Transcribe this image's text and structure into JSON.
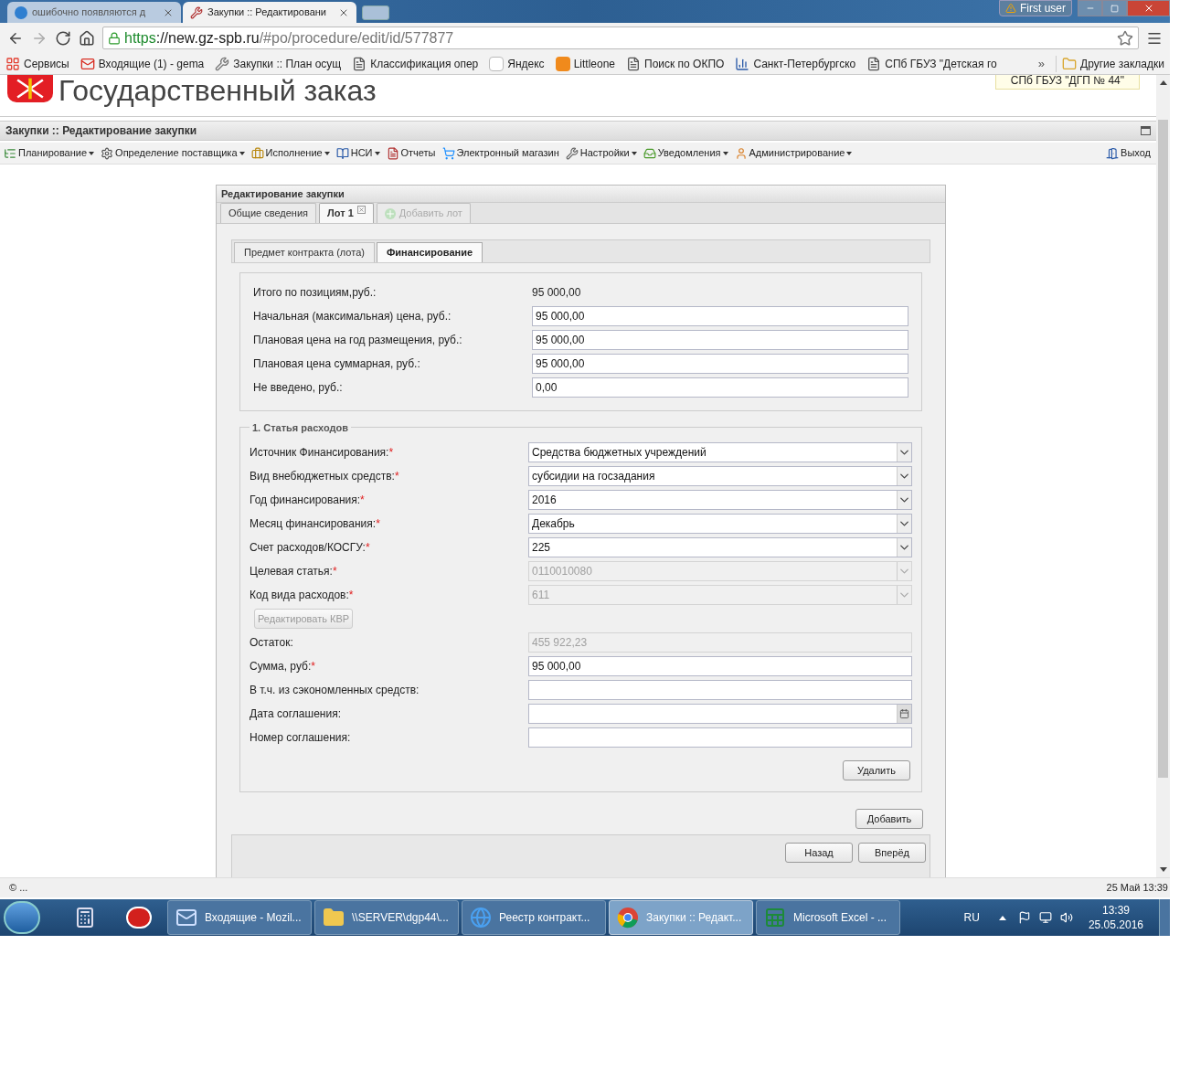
{
  "browser": {
    "tabs": [
      {
        "title": "ошибочно появляются д",
        "selected": false
      },
      {
        "title": "Закупки :: Редактировани",
        "selected": true
      }
    ],
    "user_badge": "First user",
    "url": {
      "scheme": "https",
      "host": "://new.gz-spb.ru",
      "path": "/#po/procedure/edit/id/577877"
    },
    "bookmarks": [
      {
        "label": "Сервисы"
      },
      {
        "label": "Входящие (1) - gema"
      },
      {
        "label": "Закупки :: План осущ"
      },
      {
        "label": "Классификация опер"
      },
      {
        "label": "Яндекс"
      },
      {
        "label": "Littleone"
      },
      {
        "label": "Поиск по ОКПО"
      },
      {
        "label": "Санкт-Петербургско"
      },
      {
        "label": "СПб ГБУЗ \"Детская го"
      }
    ],
    "more": "»",
    "other_bookmarks": "Другие закладки"
  },
  "header": {
    "title": "Государственный заказ",
    "organization": "СПб ГБУЗ \"ДГП № 44\""
  },
  "app_title": "Закупки :: Редактирование закупки",
  "menu": [
    {
      "label": "Планирование",
      "dropdown": true
    },
    {
      "label": "Определение поставщика",
      "dropdown": true
    },
    {
      "label": "Исполнение",
      "dropdown": true
    },
    {
      "label": "НСИ",
      "dropdown": true
    },
    {
      "label": "Отчеты",
      "dropdown": false
    },
    {
      "label": "Электронный магазин",
      "dropdown": false
    },
    {
      "label": "Настройки",
      "dropdown": true
    },
    {
      "label": "Уведомления",
      "dropdown": true
    },
    {
      "label": "Администрирование",
      "dropdown": true
    }
  ],
  "logout": "Выход",
  "form": {
    "title": "Редактирование закупки",
    "tabs": [
      {
        "label": "Общие сведения",
        "selected": false,
        "closable": false,
        "disabled": false
      },
      {
        "label": "Лот 1",
        "selected": true,
        "closable": true,
        "disabled": false
      },
      {
        "label": "Добавить лот",
        "selected": false,
        "closable": false,
        "disabled": true
      }
    ],
    "subtabs": [
      {
        "label": "Предмет контракта (лота)",
        "selected": false
      },
      {
        "label": "Финансирование",
        "selected": true
      }
    ],
    "summary": [
      {
        "label": "Итого по позициям,руб.:",
        "value": "95 000,00",
        "kind": "text"
      },
      {
        "label": "Начальная (максимальная) цена, руб.:",
        "value": "95 000,00",
        "kind": "input"
      },
      {
        "label": "Плановая цена на год размещения, руб.:",
        "value": "95 000,00",
        "kind": "input"
      },
      {
        "label": "Плановая цена суммарная, руб.:",
        "value": "95 000,00",
        "kind": "input"
      },
      {
        "label": "Не введено, руб.:",
        "value": "0,00",
        "kind": "input"
      }
    ],
    "expense": {
      "legend": "1. Статья расходов",
      "fields": [
        {
          "kind": "select",
          "label": "Источник Финансирования:",
          "required_mark": "*",
          "value": "Средства бюджетных учреждений",
          "disabled": false
        },
        {
          "kind": "select",
          "label": "Вид внебюджетных средств:",
          "required_mark": "*",
          "value": "субсидии на госзадания",
          "disabled": false
        },
        {
          "kind": "select",
          "label": "Год финансирования:",
          "required_mark": "*",
          "value": "2016",
          "disabled": false
        },
        {
          "kind": "select",
          "label": "Месяц финансирования:",
          "required_mark": "*",
          "value": "Декабрь",
          "disabled": false
        },
        {
          "kind": "select",
          "label": "Счет расходов/КОСГУ:",
          "required_mark": "*",
          "value": "225",
          "disabled": false
        },
        {
          "kind": "select",
          "label": "Целевая статья:",
          "required_mark": "*",
          "value": "0110010080",
          "disabled": true
        },
        {
          "kind": "select",
          "label": "Код вида расходов:",
          "required_mark": "*",
          "value": "611",
          "disabled": true
        },
        {
          "kind": "button",
          "label": "Редактировать КВР",
          "disabled": true
        },
        {
          "kind": "input",
          "label": "Остаток:",
          "value": "455 922,23",
          "disabled": true
        },
        {
          "kind": "input",
          "label": "Сумма, руб:",
          "required_mark": "*",
          "value": "95 000,00",
          "disabled": false
        },
        {
          "kind": "input",
          "label": "В т.ч. из сэкономленных средств:",
          "disabled": false
        },
        {
          "kind": "date",
          "label": "Дата соглашения:",
          "disabled": false
        },
        {
          "kind": "input",
          "label": "Номер соглашения:",
          "disabled": false
        }
      ],
      "delete": "Удалить"
    },
    "add": "Добавить",
    "back": "Назад",
    "next": "Вперёд"
  },
  "status_bar": {
    "left": "© ...",
    "right": "25 Май 13:39"
  },
  "taskbar": {
    "items": [
      {
        "kind": "pinned",
        "selected": false
      },
      {
        "kind": "pinned",
        "selected": false
      },
      {
        "kind": "window",
        "label": "Входящие - Mozil...",
        "selected": false
      },
      {
        "kind": "window",
        "label": "\\\\SERVER\\dgp44\\...",
        "selected": false
      },
      {
        "kind": "window",
        "label": "Реестр контракт...",
        "selected": false
      },
      {
        "kind": "window",
        "label": "Закупки :: Редакт...",
        "selected": true
      },
      {
        "kind": "window",
        "label": "Microsoft Excel - ...",
        "selected": false
      }
    ],
    "lang": "RU",
    "time": "13:39",
    "date": "25.05.2016"
  }
}
